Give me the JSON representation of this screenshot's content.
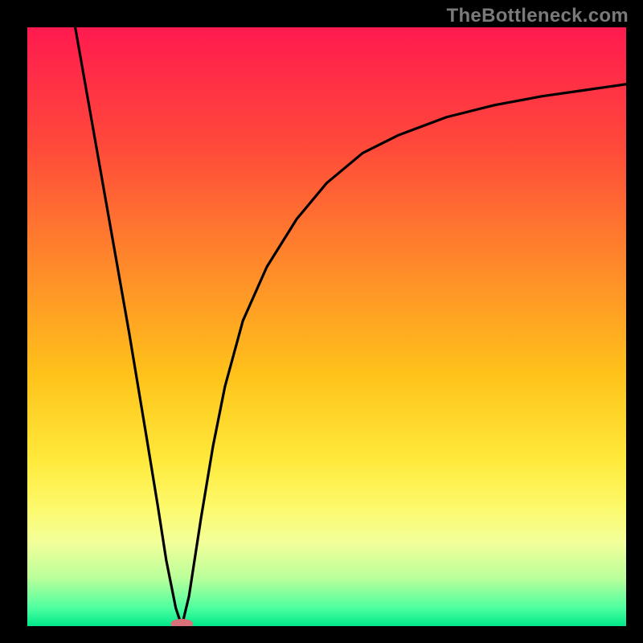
{
  "watermark": "TheBottleneck.com",
  "chart_data": {
    "type": "line",
    "title": "",
    "xlabel": "",
    "ylabel": "",
    "xlim": [
      0,
      1
    ],
    "ylim": [
      0,
      1
    ],
    "grid": false,
    "legend": false,
    "background_gradient_stops": [
      {
        "offset": 0.0,
        "color": "#ff1a4f"
      },
      {
        "offset": 0.2,
        "color": "#ff4a3a"
      },
      {
        "offset": 0.4,
        "color": "#ff8a2a"
      },
      {
        "offset": 0.58,
        "color": "#ffc21a"
      },
      {
        "offset": 0.72,
        "color": "#ffe93a"
      },
      {
        "offset": 0.8,
        "color": "#fdf96a"
      },
      {
        "offset": 0.86,
        "color": "#f3ff9a"
      },
      {
        "offset": 0.92,
        "color": "#b9ff9a"
      },
      {
        "offset": 0.97,
        "color": "#4dffa0"
      },
      {
        "offset": 1.0,
        "color": "#00e88a"
      }
    ],
    "series": [
      {
        "name": "curve",
        "color": "#000000",
        "x": [
          0.08,
          0.11,
          0.14,
          0.17,
          0.2,
          0.218,
          0.232,
          0.248,
          0.258,
          0.27,
          0.29,
          0.31,
          0.33,
          0.36,
          0.4,
          0.45,
          0.5,
          0.56,
          0.62,
          0.7,
          0.78,
          0.86,
          0.93,
          1.0
        ],
        "y": [
          1.0,
          0.83,
          0.66,
          0.49,
          0.31,
          0.2,
          0.11,
          0.03,
          0.0,
          0.05,
          0.18,
          0.3,
          0.4,
          0.51,
          0.6,
          0.68,
          0.74,
          0.79,
          0.82,
          0.85,
          0.87,
          0.885,
          0.895,
          0.905
        ]
      }
    ],
    "marker": {
      "x": 0.258,
      "y": 0.0,
      "color": "#d9717a",
      "rx": 14,
      "ry": 6
    }
  }
}
